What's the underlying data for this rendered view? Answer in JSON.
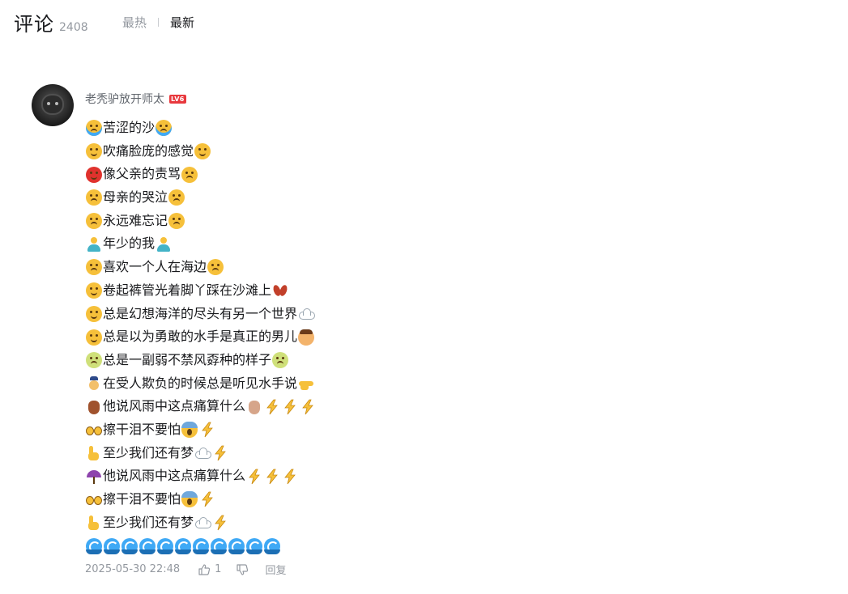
{
  "header": {
    "title": "评论",
    "count": "2408",
    "sort_hot": "最热",
    "sort_new": "最新"
  },
  "comment": {
    "username": "老秃驴放开师太",
    "level": "LV6",
    "lines": [
      {
        "pre": "cry",
        "text": "苦涩的沙",
        "post": [
          "cry"
        ]
      },
      {
        "pre": "tired",
        "text": "吹痛脸庞的感觉",
        "post": [
          "tired"
        ]
      },
      {
        "pre": "angry",
        "text": "像父亲的责骂",
        "post": [
          "sad"
        ]
      },
      {
        "pre": "sad",
        "text": "母亲的哭泣",
        "post": [
          "sad"
        ]
      },
      {
        "pre": "sad",
        "text": "永远难忘记",
        "post": [
          "sad"
        ]
      },
      {
        "pre": "person",
        "text": "年少的我",
        "post": [
          "person"
        ]
      },
      {
        "pre": "confused",
        "text": "喜欢一个人在海边",
        "post": [
          "confused"
        ]
      },
      {
        "pre": "smile",
        "text": "卷起裤管光着脚丫踩在沙滩上",
        "post": [
          "feet"
        ]
      },
      {
        "pre": "smile",
        "text": "总是幻想海洋的尽头有另一个世界",
        "post": [
          "cloud"
        ]
      },
      {
        "pre": "smile",
        "text": "总是以为勇敢的水手是真正的男儿",
        "post": [
          "boy"
        ]
      },
      {
        "pre": "sick",
        "text": "总是一副弱不禁风孬种的样子",
        "post": [
          "sick"
        ]
      },
      {
        "pre": "cop",
        "text": "在受人欺负的时候总是听见水手说",
        "post": [
          "point-right"
        ]
      },
      {
        "pre": "hand",
        "text": "他说风雨中这点痛算什么",
        "post": [
          "hand-light",
          "bolt",
          "bolt",
          "bolt"
        ]
      },
      {
        "pre": "eyes",
        "text": "擦干泪不要怕",
        "post": [
          "scream",
          "bolt"
        ]
      },
      {
        "pre": "point-up",
        "text": "至少我们还有梦",
        "post": [
          "cloud",
          "bolt"
        ]
      },
      {
        "pre": "umbrella",
        "text": "他说风雨中这点痛算什么",
        "post": [
          "bolt",
          "bolt",
          "bolt"
        ]
      },
      {
        "pre": "eyes",
        "text": "擦干泪不要怕",
        "post": [
          "scream",
          "bolt"
        ]
      },
      {
        "pre": "point-up",
        "text": "至少我们还有梦",
        "post": [
          "cloud",
          "bolt"
        ]
      },
      {
        "pre": "",
        "text": "",
        "post": [
          "wave",
          "wave",
          "wave",
          "wave",
          "wave",
          "wave",
          "wave",
          "wave",
          "wave",
          "wave",
          "wave"
        ]
      }
    ],
    "time": "2025-05-30 22:48",
    "likes": "1",
    "reply": "回复"
  },
  "colors": {
    "muted": "#9499a0",
    "text": "#18191c",
    "level_badge": "#e8383d"
  }
}
